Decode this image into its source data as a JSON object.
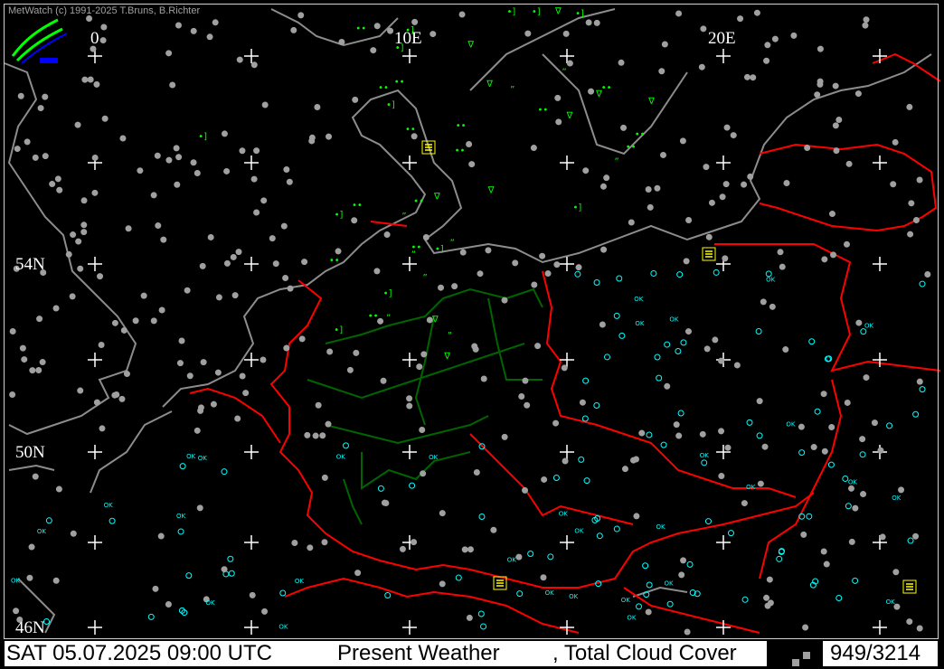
{
  "app": {
    "copyright": "MetWatch  (c) 1991-2025 T.Bruns, B.Richter",
    "logo": "metwatch-logo-icon"
  },
  "map": {
    "longitude_labels": [
      "0",
      "10E",
      "20E"
    ],
    "latitude_labels": [
      "54N",
      "50N",
      "46N"
    ],
    "colors": {
      "background": "#000000",
      "coastline": "#8c8c8c",
      "borders": "#ff0000",
      "german_states": "#006400",
      "grid": "#ffffff",
      "precip": "#00ff00",
      "clear": "#00ffff",
      "cloud": "#a0a0a0",
      "thunder": "#ffff00"
    },
    "station_symbols": [
      "cloud-cover-circle-icon",
      "drizzle-icon",
      "rain-shower-icon",
      "fog-icon",
      "thunderstorm-icon",
      "ok-label"
    ],
    "ok_text": "OK"
  },
  "status": {
    "datetime": "SAT 05.07.2025 09:00 UTC",
    "product": "Present Weather",
    "overlay": ", Total Cloud Cover",
    "count": "949/3214"
  }
}
